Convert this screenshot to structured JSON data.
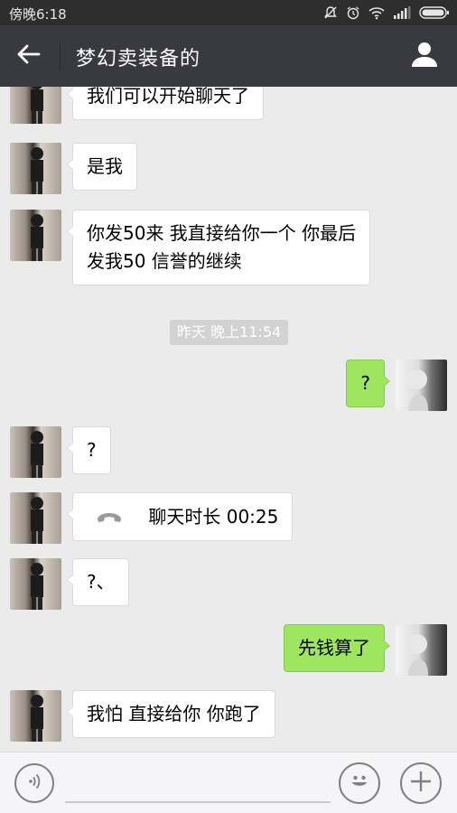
{
  "status_bar": {
    "time": "傍晚6:18",
    "icons": [
      "mute-icon",
      "alarm-icon",
      "wifi-icon",
      "signal-icon",
      "battery-icon"
    ]
  },
  "header": {
    "title": "梦幻卖装备的",
    "back_icon": "back-arrow-icon",
    "profile_icon": "person-icon",
    "background": "#393a3f"
  },
  "messages": [
    {
      "side": "them",
      "lines": [
        "我们可以开始聊天了"
      ]
    },
    {
      "side": "them",
      "lines": [
        "是我"
      ]
    },
    {
      "side": "them",
      "lines": [
        "你发50来 我直接给你一个 你最后",
        "发我50  信誉的继续"
      ]
    },
    {
      "side": "timestamp",
      "text": "昨天 晚上11:54"
    },
    {
      "side": "me",
      "lines": [
        "?"
      ]
    },
    {
      "side": "them",
      "lines": [
        "?"
      ]
    },
    {
      "side": "them",
      "type": "call",
      "icon": "phone-hangup-icon",
      "lines": [
        "聊天时长 00:25"
      ]
    },
    {
      "side": "them",
      "lines": [
        "?、"
      ]
    },
    {
      "side": "me",
      "lines": [
        "先钱算了"
      ]
    },
    {
      "side": "them",
      "lines": [
        "我怕 直接给你 你跑了"
      ]
    }
  ],
  "input_bar": {
    "value": "",
    "voice_icon": "voice-icon",
    "emoji_icon": "emoji-icon",
    "plus_icon": "plus-icon"
  },
  "colors": {
    "chat_background": "#ebebeb",
    "my_bubble": "#9ee65f",
    "their_bubble": "#ffffff"
  }
}
